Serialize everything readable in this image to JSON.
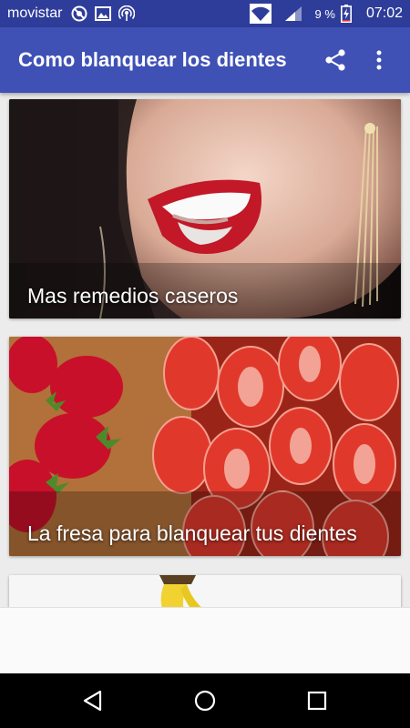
{
  "status_bar": {
    "carrier": "movistar",
    "battery_percent": "9 %",
    "time": "07:02",
    "icons": [
      "blocked-icon",
      "image-icon",
      "hotspot-icon",
      "wifi-icon",
      "signal-icon",
      "battery-charging-icon"
    ]
  },
  "app_bar": {
    "title": "Como blanquear los dientes",
    "actions": [
      "share-icon",
      "more-vert-icon"
    ]
  },
  "cards": [
    {
      "label": "Mas remedios caseros"
    },
    {
      "label": "La fresa para blanquear tus dientes"
    },
    {
      "label": ""
    }
  ],
  "nav_bar": {
    "buttons": [
      "back-icon",
      "home-icon",
      "recents-icon"
    ]
  },
  "colors": {
    "status_bar": "#2f3d9a",
    "app_bar": "#3f51b5",
    "background": "#ececec"
  }
}
